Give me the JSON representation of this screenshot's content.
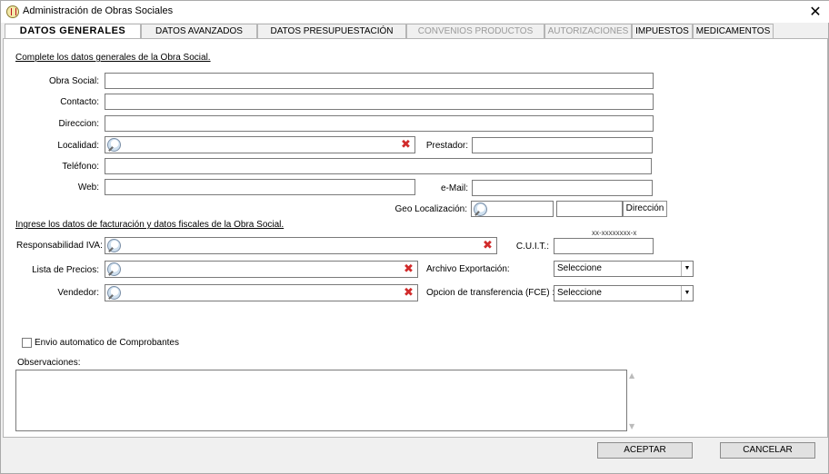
{
  "window": {
    "title": "Administración de Obras Sociales",
    "close": "✕"
  },
  "tabs": [
    {
      "label": "DATOS GENERALES",
      "state": "active"
    },
    {
      "label": "DATOS AVANZADOS",
      "state": "normal"
    },
    {
      "label": "DATOS PRESUPUESTACIÓN",
      "state": "normal"
    },
    {
      "label": "CONVENIOS PRODUCTOS",
      "state": "disabled"
    },
    {
      "label": "AUTORIZACIONES",
      "state": "disabled"
    },
    {
      "label": "IMPUESTOS",
      "state": "normal"
    },
    {
      "label": "MEDICAMENTOS",
      "state": "normal"
    }
  ],
  "general": {
    "section": "Complete los datos generales de la Obra Social.",
    "obra_social_label": "Obra Social:",
    "obra_social_value": "",
    "contacto_label": "Contacto:",
    "contacto_value": "",
    "direccion_label": "Direccion:",
    "direccion_value": "",
    "localidad_label": "Localidad:",
    "localidad_value": "",
    "prestador_label": "Prestador:",
    "prestador_value": "",
    "telefono_label": "Teléfono:",
    "telefono_value": "",
    "web_label": "Web:",
    "web_value": "",
    "email_label": "e-Mail:",
    "email_value": "",
    "geo_label": "Geo Localización:",
    "geo_value": "",
    "geo_extra_value": "",
    "direccion_button": "Dirección"
  },
  "fiscal": {
    "section": "Ingrese los datos de facturación y datos fiscales de la Obra Social.",
    "resp_iva_label": "Responsabilidad IVA:",
    "resp_iva_value": "",
    "cuit_hint": "xx-xxxxxxxx-x",
    "cuit_label": "C.U.I.T.:",
    "cuit_value": "",
    "lista_precios_label": "Lista de Precios:",
    "lista_precios_value": "",
    "archivo_label": "Archivo Exportación:",
    "archivo_selected": "Seleccione",
    "vendedor_label": "Vendedor:",
    "vendedor_value": "",
    "opcion_label": "Opcion de transferencia (FCE) :",
    "opcion_selected": "Seleccione"
  },
  "envio": {
    "label": "Envio automatico de Comprobantes",
    "checked": false
  },
  "observaciones": {
    "label": "Observaciones:",
    "value": ""
  },
  "footer": {
    "accept": "ACEPTAR",
    "cancel": "CANCELAR"
  },
  "icons": {
    "search": "magnifier-icon",
    "clear": "red-x-icon",
    "dropdown": "chevron-down-icon"
  }
}
